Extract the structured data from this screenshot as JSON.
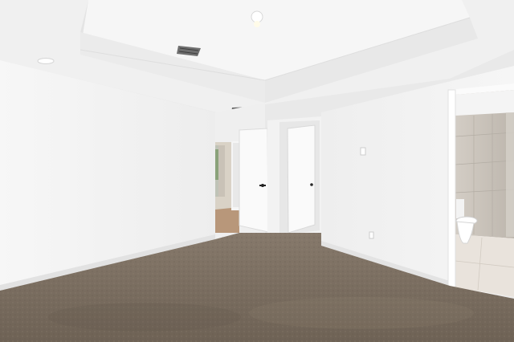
{
  "scene": {
    "kind": "photo",
    "subject": "empty-bedroom-interior",
    "visible_text": [],
    "colors": {
      "wall": "#f4f4f4",
      "wall_shadow": "#e6e6e6",
      "ceiling": "#f1f1f1",
      "tray_ceiling": "#f6f6f6",
      "door": "#f9f9f9",
      "carpet": "#7b6e60",
      "carpet_dark": "#5f5448",
      "bathroom_tile": "#c9c3bb",
      "hall_floor": "#b89c7a",
      "handle": "#222222"
    },
    "icons": [
      "ceiling-light-icon",
      "air-vent-icon",
      "smoke-detector-icon",
      "light-switch-icon",
      "wall-outlet-icon",
      "toilet-icon"
    ]
  }
}
